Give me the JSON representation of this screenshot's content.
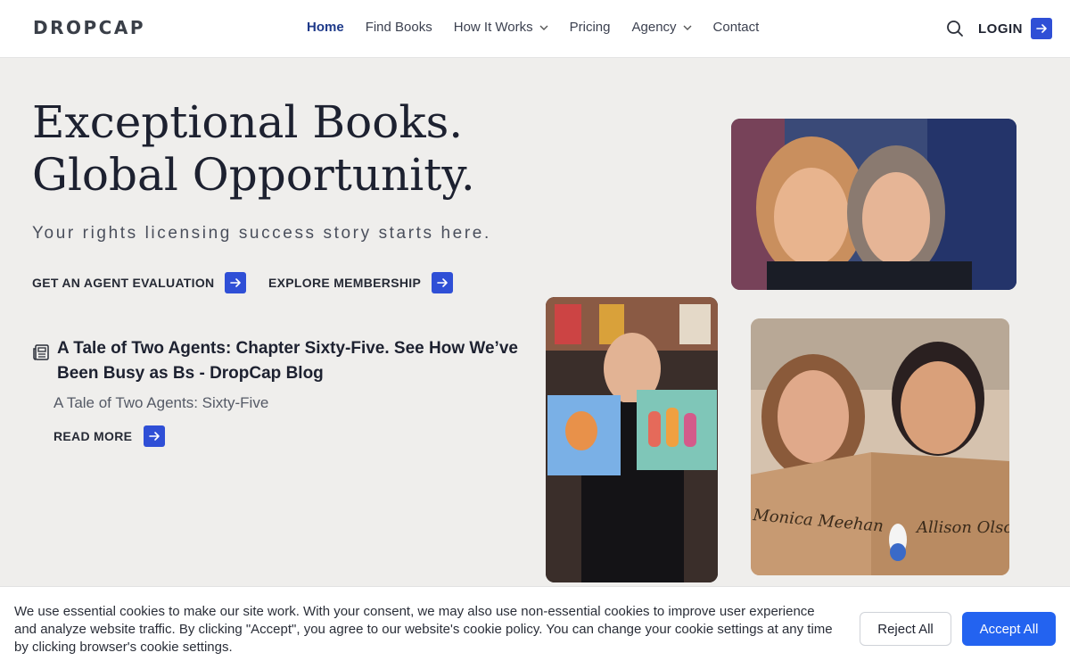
{
  "header": {
    "logo": "DROPCAP",
    "nav": [
      {
        "label": "Home",
        "active": true,
        "dropdown": false
      },
      {
        "label": "Find Books",
        "active": false,
        "dropdown": false
      },
      {
        "label": "How It Works",
        "active": false,
        "dropdown": true
      },
      {
        "label": "Pricing",
        "active": false,
        "dropdown": false
      },
      {
        "label": "Agency",
        "active": false,
        "dropdown": true
      },
      {
        "label": "Contact",
        "active": false,
        "dropdown": false
      }
    ],
    "search_icon": "search-icon",
    "login_label": "LOGIN"
  },
  "hero": {
    "title_line1": "Exceptional Books.",
    "title_line2": "Global Opportunity.",
    "tagline": "Your rights licensing success story starts here.",
    "cta_evaluation": "GET AN AGENT EVALUATION",
    "cta_membership": "EXPLORE MEMBERSHIP"
  },
  "blog": {
    "icon": "newspaper-icon",
    "title": "A Tale of Two Agents: Chapter Sixty-Five. See How We’ve Been Busy as Bs - DropCap Blog",
    "subtitle": "A Tale of Two Agents: Sixty-Five",
    "read_more": "READ MORE"
  },
  "photos": {
    "photo3_caption_left": "Monica Meehan",
    "photo3_caption_right": "Allison Olso"
  },
  "cookie": {
    "text": "We use essential cookies to make our site work. With your consent, we may also use non-essential cookies to improve user experience and analyze website traffic. By clicking \"Accept\", you agree to our website's cookie policy. You can change your cookie settings at any time by clicking browser's cookie settings.",
    "reject_label": "Reject All",
    "accept_label": "Accept All"
  },
  "colors": {
    "accent": "#2f4fd6",
    "accept_button": "#2363f0",
    "active_nav": "#1e3a8a",
    "background": "#efeeec"
  }
}
